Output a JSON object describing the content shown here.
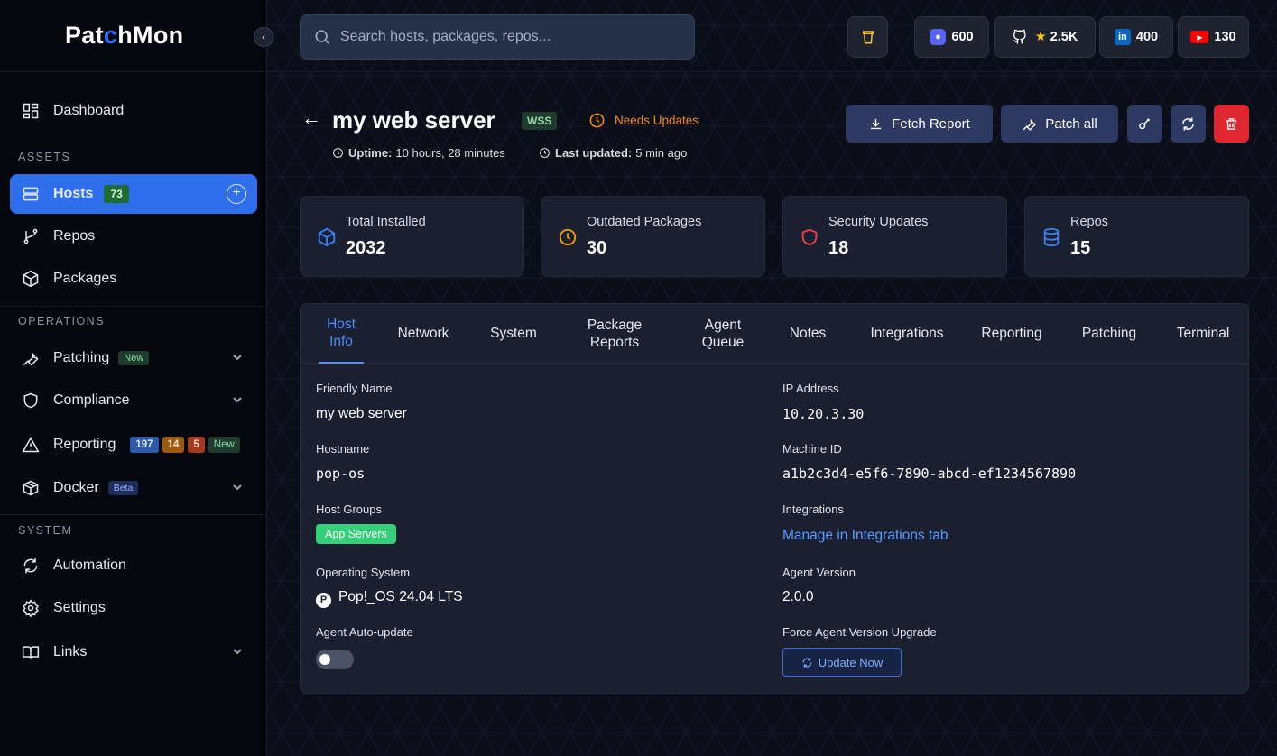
{
  "app": {
    "logo_a": "Pat",
    "logo_c": "c",
    "logo_b": "hMon"
  },
  "sidebar": {
    "dashboard": "Dashboard",
    "section_assets": "ASSETS",
    "hosts": "Hosts",
    "hosts_count": "73",
    "repos": "Repos",
    "packages": "Packages",
    "section_operations": "OPERATIONS",
    "patching": "Patching",
    "patching_badge": "New",
    "compliance": "Compliance",
    "reporting": "Reporting",
    "reporting_badges": [
      "197",
      "14",
      "5",
      "New"
    ],
    "docker": "Docker",
    "docker_badge": "Beta",
    "section_system": "SYSTEM",
    "automation": "Automation",
    "settings": "Settings",
    "links": "Links"
  },
  "topbar": {
    "search_placeholder": "Search hosts, packages, repos...",
    "discord": "600",
    "github_stars": "2.5K",
    "linkedin": "400",
    "youtube": "130"
  },
  "host": {
    "name": "my web server",
    "tag": "WSS",
    "status": "Needs Updates",
    "uptime_label": "Uptime:",
    "uptime_value": "10 hours, 28 minutes",
    "last_updated_label": "Last updated:",
    "last_updated_value": "5 min ago"
  },
  "actions": {
    "fetch_report": "Fetch Report",
    "patch_all": "Patch all"
  },
  "stats": [
    {
      "label": "Total Installed",
      "value": "2032",
      "color": "#3b82f6"
    },
    {
      "label": "Outdated Packages",
      "value": "30",
      "color": "#f59e0b"
    },
    {
      "label": "Security Updates",
      "value": "18",
      "color": "#ef4444"
    },
    {
      "label": "Repos",
      "value": "15",
      "color": "#3b82f6"
    }
  ],
  "tabs": [
    "Host Info",
    "Network",
    "System",
    "Package Reports",
    "Agent Queue",
    "Notes",
    "Integrations",
    "Reporting",
    "Patching",
    "Terminal"
  ],
  "info": {
    "friendly_name_label": "Friendly Name",
    "friendly_name": "my web server",
    "hostname_label": "Hostname",
    "hostname": "pop-os",
    "host_groups_label": "Host Groups",
    "host_group": "App Servers",
    "os_label": "Operating System",
    "os": "Pop!_OS 24.04 LTS",
    "auto_update_label": "Agent Auto-update",
    "ip_label": "IP Address",
    "ip": "10.20.3.30",
    "machine_id_label": "Machine ID",
    "machine_id": "a1b2c3d4-e5f6-7890-abcd-ef1234567890",
    "integrations_label": "Integrations",
    "integrations_link": "Manage in Integrations tab",
    "agent_version_label": "Agent Version",
    "agent_version": "2.0.0",
    "force_upgrade_label": "Force Agent Version Upgrade",
    "update_now": "Update Now"
  }
}
